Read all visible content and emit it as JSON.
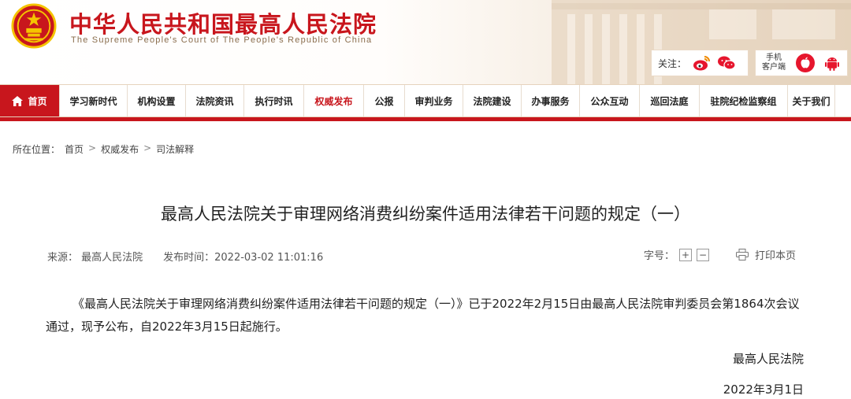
{
  "header": {
    "title": "中华人民共和国最高人民法院",
    "subtitle": "The Supreme People's Court of The People's Republic of China",
    "follow_label": "关注：",
    "client_label": "手机\n客户端",
    "icons": [
      "national-emblem-icon",
      "weibo-icon",
      "wechat-icon",
      "apple-icon",
      "android-icon"
    ]
  },
  "nav": {
    "items": [
      {
        "label": "首页"
      },
      {
        "label": "学习新时代"
      },
      {
        "label": "机构设置"
      },
      {
        "label": "法院资讯"
      },
      {
        "label": "执行时讯"
      },
      {
        "label": "权威发布"
      },
      {
        "label": "公报"
      },
      {
        "label": "审判业务"
      },
      {
        "label": "法院建设"
      },
      {
        "label": "办事服务"
      },
      {
        "label": "公众互动"
      },
      {
        "label": "巡回法庭"
      },
      {
        "label": "驻院纪检监察组"
      },
      {
        "label": "关于我们"
      }
    ]
  },
  "breadcrumb": {
    "prefix": "所在位置：",
    "items": [
      "首页",
      "权威发布",
      "司法解释"
    ],
    "separator": ">"
  },
  "article": {
    "title": "最高人民法院关于审理网络消费纠纷案件适用法律若干问题的规定（一）",
    "source": "来源：  最高人民法院",
    "published": "发布时间：2022-03-02 11:01:16",
    "font_label": "字号：",
    "font_plus": "+",
    "font_minus": "−",
    "print_label": "打印本页",
    "body": "《最高人民法院关于审理网络消费纠纷案件适用法律若干问题的规定（一）》已于2022年2月15日由最高人民法院审判委员会第1864次会议通过，现予公布，自2022年3月15日起施行。",
    "signature": "最高人民法院",
    "date": "2022年3月1日"
  },
  "colors": {
    "brand_red": "#c8161d",
    "accent_gold": "#f5c400"
  }
}
